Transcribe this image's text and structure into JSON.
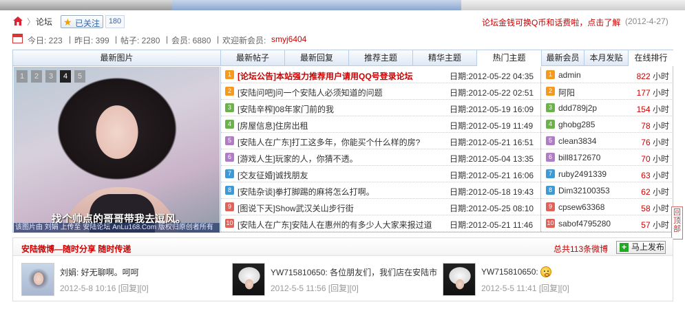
{
  "breadcrumb": {
    "separator": "〉",
    "forum": "论坛"
  },
  "follow": {
    "label": "已关注",
    "count": "180"
  },
  "notice": {
    "text": "论坛金钱可换Q币和话费啦，点击了解",
    "date": "(2012-4-27)"
  },
  "stats": {
    "today": "今日: 223",
    "yesterday": "昨日: 399",
    "posts": "帖子: 2280",
    "members": "会员: 6880",
    "welcome": "欢迎新会员:",
    "new_member": "smyj6404",
    "divider": "|"
  },
  "tabs": {
    "image_tab": "最新图片",
    "post_tabs": [
      "最新帖子",
      "最新回复",
      "推荐主题",
      "精华主题",
      "热门主题"
    ],
    "member_tabs": [
      "最新会员",
      "本月发贴",
      "在线排行"
    ]
  },
  "slideshow": {
    "pages": [
      "1",
      "2",
      "3",
      "4",
      "5"
    ],
    "active_page": 4,
    "caption": "找个帅点的哥哥带我去逗风。",
    "credit": "该图片由 刘娟 上传至 安陆论坛 AnLu168.Com 版权归原创者所有"
  },
  "posts": [
    {
      "num": "1",
      "title": "[论坛公告]本站强力推荐用户请用QQ号登录论坛",
      "date": "日期:2012-05-22 04:35",
      "hot": true
    },
    {
      "num": "2",
      "title": "[安陆问吧]问一个安陆人必须知道的问题",
      "date": "日期:2012-05-22 02:51",
      "hot": false
    },
    {
      "num": "3",
      "title": "[安陆辛榨]08年家门前的我",
      "date": "日期:2012-05-19 16:09",
      "hot": false
    },
    {
      "num": "4",
      "title": "[房屋信息]住房出租",
      "date": "日期:2012-05-19 11:49",
      "hot": false
    },
    {
      "num": "5",
      "title": "[安陆人在广东]打工这多年，你能买个什么样的房?",
      "date": "日期:2012-05-21 16:51",
      "hot": false
    },
    {
      "num": "6",
      "title": "[游戏人生]玩家的人，你猜不透。",
      "date": "日期:2012-05-04 13:35",
      "hot": false
    },
    {
      "num": "7",
      "title": "[交友征婚]诚找朋友",
      "date": "日期:2012-05-21 16:06",
      "hot": false
    },
    {
      "num": "8",
      "title": "[安陆杂谈]拳打脚踢的麻将怎么打啊。",
      "date": "日期:2012-05-18 19:43",
      "hot": false
    },
    {
      "num": "9",
      "title": "[图说下天]Show武汉关山步行街",
      "date": "日期:2012-05-25 08:10",
      "hot": false
    },
    {
      "num": "10",
      "title": "[安陆人在广东]安陆人在惠州的有多少人大家来报过道",
      "date": "日期:2012-05-21 11:46",
      "hot": false
    }
  ],
  "members": [
    {
      "num": "1",
      "name": "admin",
      "hours": "822",
      "unit": "小时"
    },
    {
      "num": "2",
      "name": "阿阳",
      "hours": "177",
      "unit": "小时"
    },
    {
      "num": "3",
      "name": "ddd789j2p",
      "hours": "154",
      "unit": "小时"
    },
    {
      "num": "4",
      "name": "ghobg285",
      "hours": "78",
      "unit": "小时"
    },
    {
      "num": "5",
      "name": "clean3834",
      "hours": "76",
      "unit": "小时"
    },
    {
      "num": "6",
      "name": "bill8172670",
      "hours": "70",
      "unit": "小时"
    },
    {
      "num": "7",
      "name": "ruby2491339",
      "hours": "63",
      "unit": "小时"
    },
    {
      "num": "8",
      "name": "Dim32100353",
      "hours": "62",
      "unit": "小时"
    },
    {
      "num": "9",
      "name": "cpsew63368",
      "hours": "58",
      "unit": "小时"
    },
    {
      "num": "10",
      "name": "sabof4795280",
      "hours": "57",
      "unit": "小时"
    }
  ],
  "num_colors": [
    "#f39a1f",
    "#f39a1f",
    "#6bb24a",
    "#6bb24a",
    "#b07cc6",
    "#b07cc6",
    "#3d9ad6",
    "#3d9ad6",
    "#e0635b",
    "#e0635b"
  ],
  "back_to_top": "回顶部",
  "weibo": {
    "title": "安陆微博—随时分享 随时传递",
    "total": "总共113条微博",
    "publish": "马上发布",
    "items": [
      {
        "text": "刘娟: 好无聊啊。呵呵",
        "meta": "2012-5-8 10:16 [回复][0]"
      },
      {
        "text": "YW715810650: 各位朋友们，我们店在安陆市",
        "meta": "2012-5-5 11:56 [回复][0]"
      },
      {
        "text": "YW715810650:",
        "meta": "2012-5-5 11:41 [回复][0]"
      }
    ]
  }
}
